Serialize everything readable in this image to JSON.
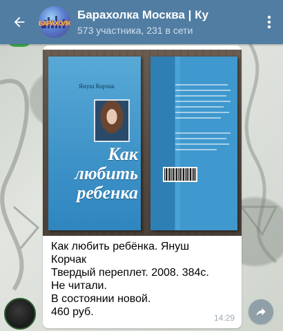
{
  "header": {
    "title": "Барахолка Москва | Ку",
    "subtitle": "573 участника, 231 в сети",
    "avatar_logo_text": "БАРАХОЛКА"
  },
  "message": {
    "book": {
      "author": "Януш Корчак",
      "title_line1": "Как",
      "title_line2": "любить",
      "title_line3": "ребенка"
    },
    "caption_lines": [
      "Как любить ребёнка. Януш",
      "Корчак",
      "Твердый переплет. 2008. 384с.",
      "Не читали.",
      "В состоянии новой.",
      "460 руб."
    ],
    "time": "14:29"
  },
  "icons": {
    "back": "arrow-left-icon",
    "menu": "more-vertical-icon",
    "share": "share-arrow-icon"
  },
  "colors": {
    "header": "#517da2",
    "book_cover": "#3d92c7"
  }
}
